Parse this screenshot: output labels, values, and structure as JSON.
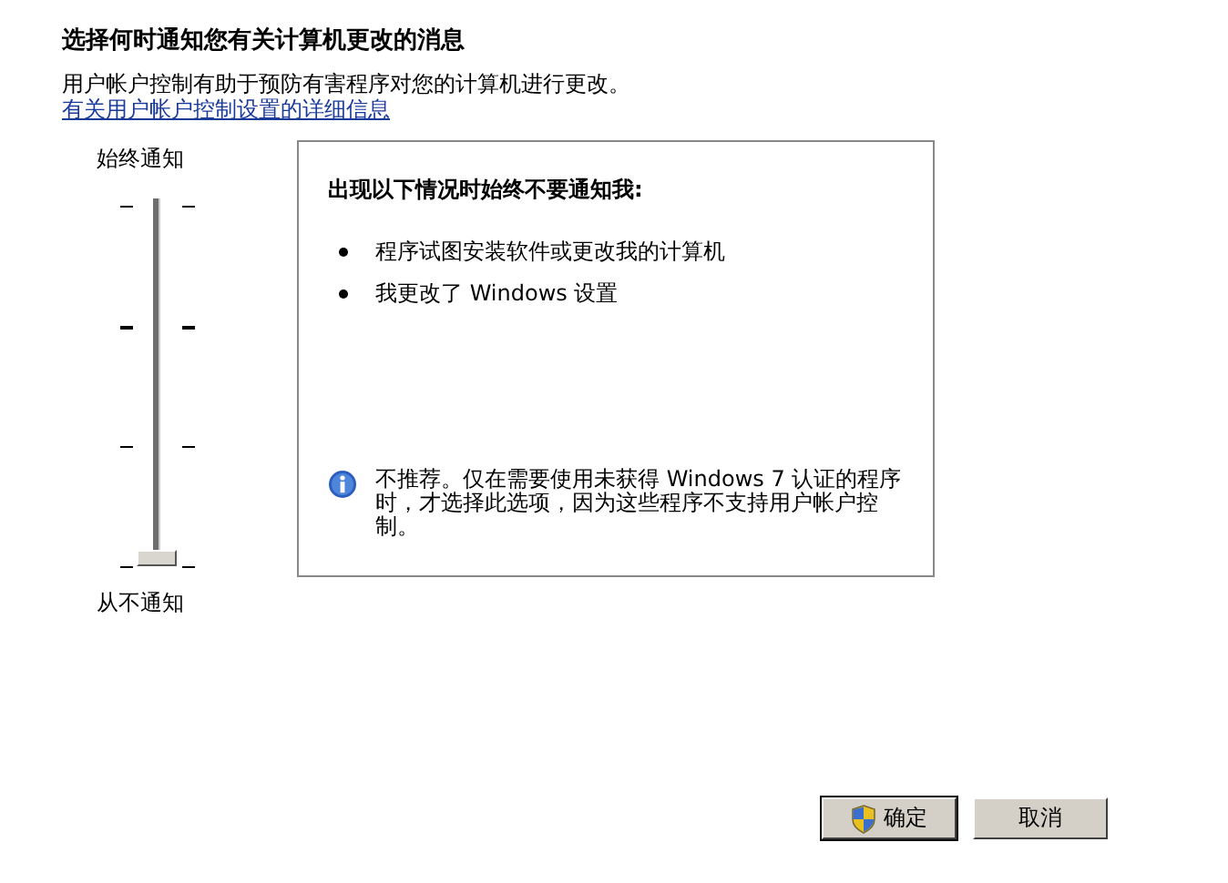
{
  "heading": "选择何时通知您有关计算机更改的消息",
  "description": "用户帐户控制有助于预防有害程序对您的计算机进行更改。",
  "help_link": "有关用户帐户控制设置的详细信息",
  "slider": {
    "top_label": "始终通知",
    "bottom_label": "从不通知",
    "level": 0
  },
  "panel": {
    "title": "出现以下情况时始终不要通知我:",
    "bullets": [
      "程序试图安装软件或更改我的计算机",
      "我更改了 Windows 设置"
    ],
    "note": "不推荐。仅在需要使用未获得 Windows 7 认证的程序时，才选择此选项，因为这些程序不支持用户帐户控制。"
  },
  "buttons": [
    {
      "label": "确定",
      "kind": "shield"
    },
    {
      "label": "取消",
      "kind": "plain"
    }
  ]
}
